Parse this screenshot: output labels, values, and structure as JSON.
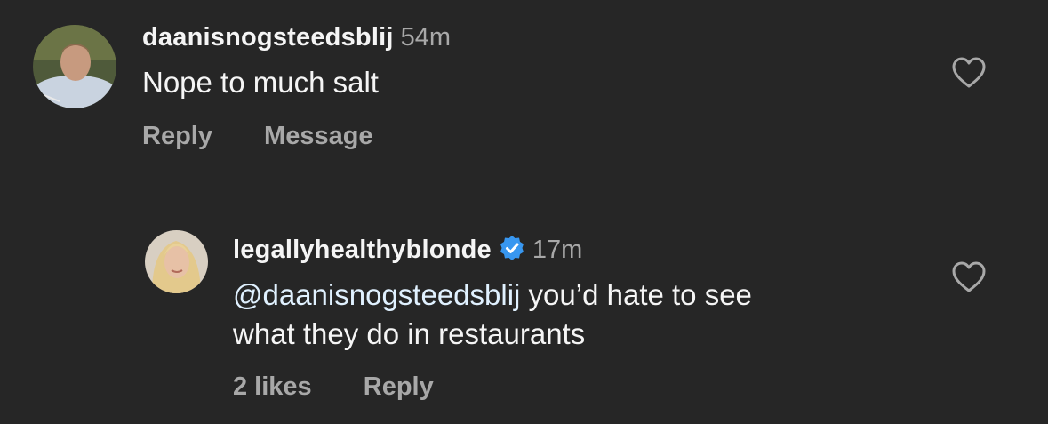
{
  "comments": [
    {
      "username": "daanisnogsteedsblij",
      "time": "54m",
      "text": "Nope to much salt",
      "actions": {
        "reply": "Reply",
        "message": "Message"
      }
    },
    {
      "username": "legallyhealthyblonde",
      "verified": true,
      "time": "17m",
      "mention": "@daanisnogsteedsblij",
      "text_line1": " you’d hate to see",
      "text_line2": "what they do in restaurants",
      "actions": {
        "likes": "2 likes",
        "reply": "Reply"
      }
    }
  ],
  "colors": {
    "background": "#262626",
    "primary_text": "#f5f5f5",
    "secondary_text": "#a8a8a8",
    "verified_badge": "#3897f0"
  },
  "icons": [
    "avatar",
    "heart-icon",
    "verified-badge-icon"
  ]
}
